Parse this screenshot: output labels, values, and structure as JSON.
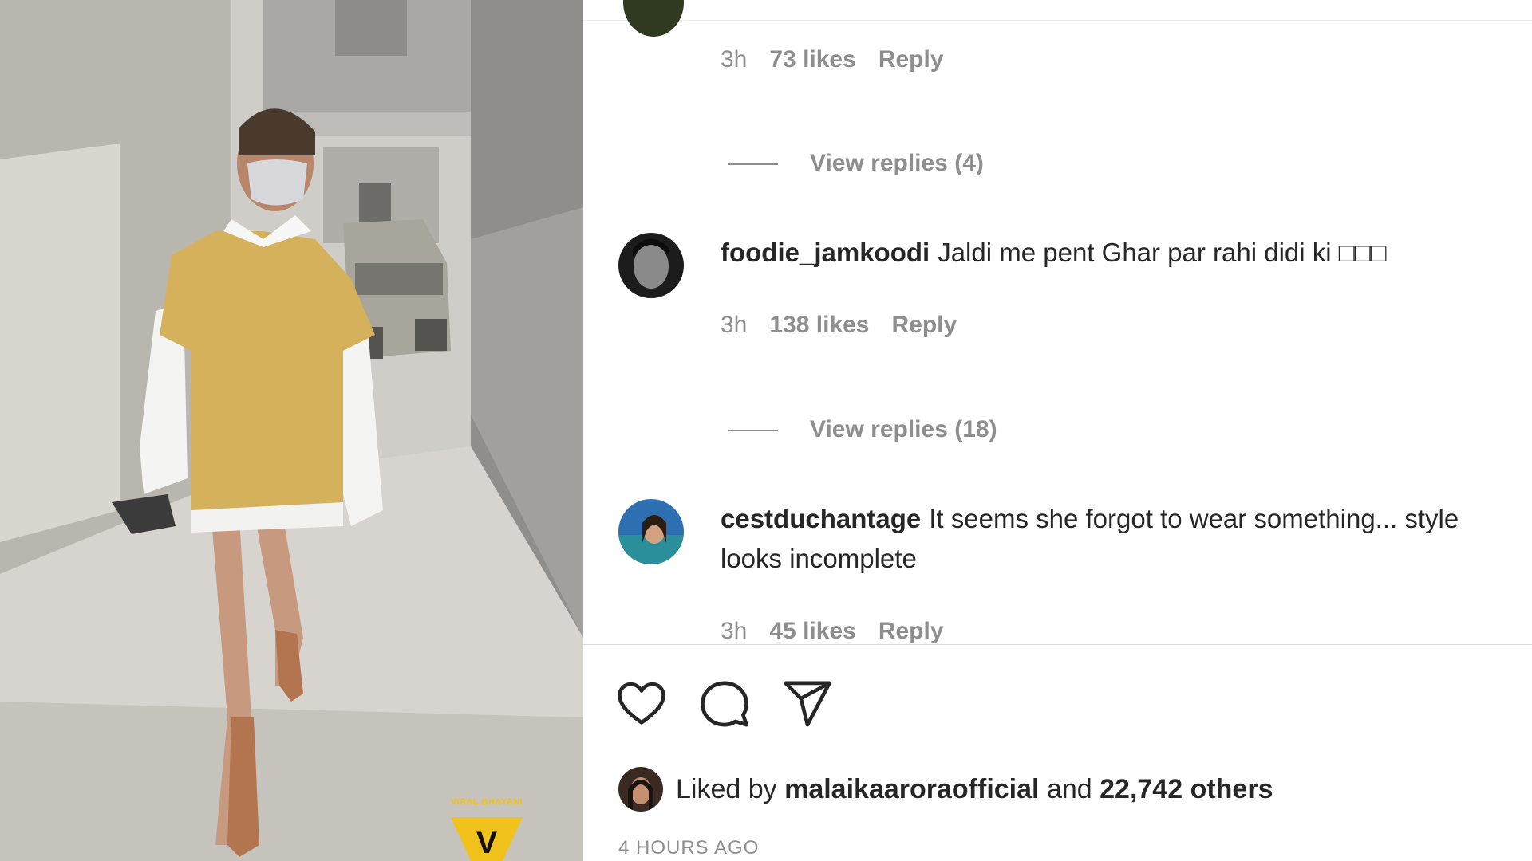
{
  "media": {
    "watermark_text": "VIRAL BHAYANI",
    "watermark_logo": "V"
  },
  "comments": [
    {
      "partial": true,
      "time": "3h",
      "likes": "73 likes",
      "reply": "Reply",
      "view_replies": "View replies (4)"
    },
    {
      "username": "foodie_jamkoodi",
      "text": "Jaldi me pent Ghar par rahi didi ki □□□",
      "time": "3h",
      "likes": "138 likes",
      "reply": "Reply",
      "view_replies": "View replies (18)"
    },
    {
      "username": "cestduchantage",
      "text": "It seems she forgot to wear something... style looks incomplete",
      "time": "3h",
      "likes": "45 likes",
      "reply": "Reply"
    }
  ],
  "actions": {
    "like_icon": "heart-icon",
    "comment_icon": "comment-icon",
    "share_icon": "paper-plane-icon"
  },
  "liked_by": {
    "prefix": "Liked by",
    "user": "malaikaaroraofficial",
    "middle": "and",
    "others": "22,742 others"
  },
  "timestamp": "4 HOURS AGO"
}
